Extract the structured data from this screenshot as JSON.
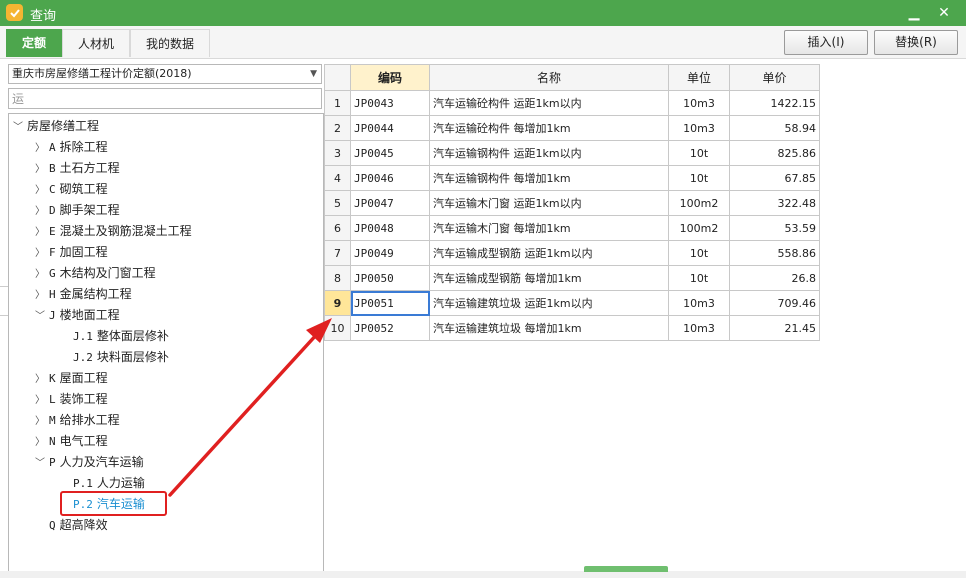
{
  "window": {
    "title": "查询",
    "minimize": "▁",
    "close": "✕"
  },
  "tabs": [
    {
      "label": "定额",
      "active": true
    },
    {
      "label": "人材机",
      "active": false
    },
    {
      "label": "我的数据",
      "active": false
    }
  ],
  "buttons": {
    "insert": "插入(I)",
    "replace": "替换(R)"
  },
  "library_select": {
    "value": "重庆市房屋修缮工程计价定额(2018)"
  },
  "search": {
    "value": "运"
  },
  "tree": {
    "root": "房屋修缮工程",
    "items": [
      {
        "code": "A",
        "label": "拆除工程"
      },
      {
        "code": "B",
        "label": "土石方工程"
      },
      {
        "code": "C",
        "label": "砌筑工程"
      },
      {
        "code": "D",
        "label": "脚手架工程"
      },
      {
        "code": "E",
        "label": "混凝土及钢筋混凝土工程"
      },
      {
        "code": "F",
        "label": "加固工程"
      },
      {
        "code": "G",
        "label": "木结构及门窗工程"
      },
      {
        "code": "H",
        "label": "金属结构工程"
      },
      {
        "code": "J",
        "label": "楼地面工程"
      },
      {
        "code": "J.1",
        "label": "整体面层修补"
      },
      {
        "code": "J.2",
        "label": "块料面层修补"
      },
      {
        "code": "K",
        "label": "屋面工程"
      },
      {
        "code": "L",
        "label": "装饰工程"
      },
      {
        "code": "M",
        "label": "给排水工程"
      },
      {
        "code": "N",
        "label": "电气工程"
      },
      {
        "code": "P",
        "label": "人力及汽车运输"
      },
      {
        "code": "P.1",
        "label": "人力运输"
      },
      {
        "code": "P.2",
        "label": "汽车运输"
      },
      {
        "code": "Q",
        "label": "超高降效"
      }
    ]
  },
  "table": {
    "headers": {
      "code": "编码",
      "name": "名称",
      "unit": "单位",
      "price": "单价"
    },
    "rows": [
      {
        "n": "1",
        "code": "JP0043",
        "name": "汽车运输砼构件 运距1km以内",
        "unit": "10m3",
        "price": "1422.15"
      },
      {
        "n": "2",
        "code": "JP0044",
        "name": "汽车运输砼构件 每增加1km",
        "unit": "10m3",
        "price": "58.94"
      },
      {
        "n": "3",
        "code": "JP0045",
        "name": "汽车运输钢构件 运距1km以内",
        "unit": "10t",
        "price": "825.86"
      },
      {
        "n": "4",
        "code": "JP0046",
        "name": "汽车运输钢构件 每增加1km",
        "unit": "10t",
        "price": "67.85"
      },
      {
        "n": "5",
        "code": "JP0047",
        "name": "汽车运输木门窗 运距1km以内",
        "unit": "100m2",
        "price": "322.48"
      },
      {
        "n": "6",
        "code": "JP0048",
        "name": "汽车运输木门窗 每增加1km",
        "unit": "100m2",
        "price": "53.59"
      },
      {
        "n": "7",
        "code": "JP0049",
        "name": "汽车运输成型钢筋 运距1km以内",
        "unit": "10t",
        "price": "558.86"
      },
      {
        "n": "8",
        "code": "JP0050",
        "name": "汽车运输成型钢筋 每增加1km",
        "unit": "10t",
        "price": "26.8"
      },
      {
        "n": "9",
        "code": "JP0051",
        "name": "汽车运输建筑垃圾 运距1km以内",
        "unit": "10m3",
        "price": "709.46"
      },
      {
        "n": "10",
        "code": "JP0052",
        "name": "汽车运输建筑垃圾 每增加1km",
        "unit": "10m3",
        "price": "21.45"
      }
    ]
  },
  "colors": {
    "brand": "#4da64d",
    "annotation": "#e02020",
    "selected_text": "#1a8fd1"
  }
}
